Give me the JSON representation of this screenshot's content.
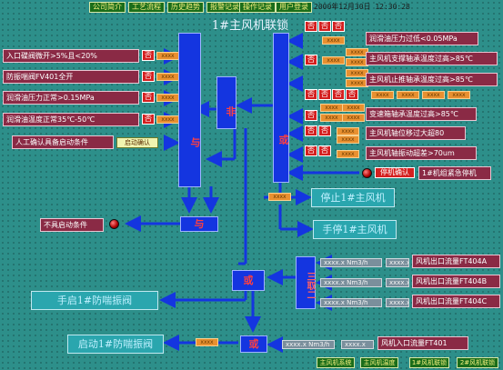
{
  "menu": [
    "公司简介",
    "工艺流程",
    "历史趋势",
    "报警记录",
    "操作记录",
    "用户登录"
  ],
  "datetime": "2000年12月30日  12:30:28",
  "title": "1#主风机联锁",
  "left_conditions": [
    {
      "label": "入口碟阀微开>5%且<20%",
      "state": "否",
      "value": "xxxx"
    },
    {
      "label": "防振喘阀FV401全开",
      "state": "否",
      "value": "xxxx"
    },
    {
      "label": "润滑油压力正常>0.15MPa",
      "state": "否",
      "value": "xxxx"
    },
    {
      "label": "润滑油温度正常35℃-50℃",
      "state": "否",
      "value": "xxxx"
    },
    {
      "label": "人工确认具备启动条件",
      "confirm": "启动确认"
    }
  ],
  "right_conditions": [
    {
      "label": "润滑油压力过低<0.05MPa",
      "states": [
        "否",
        "否",
        "否"
      ]
    },
    {
      "label": "主风机支撑轴承温度过高>85℃",
      "states": [
        "否",
        "否",
        "否",
        "否"
      ]
    },
    {
      "label": "主风机止推轴承温度过高>85℃",
      "states": [
        "否",
        "否",
        "否",
        "否"
      ]
    },
    {
      "label": "变速箱轴承温度过高>85℃",
      "states": [
        "否",
        "否",
        "否",
        "否"
      ]
    },
    {
      "label": "主风机轴位移过大超80",
      "states": [
        "否",
        "否"
      ]
    },
    {
      "label": "主风机轴振动超差>70um",
      "states": [
        "否",
        "否"
      ]
    },
    {
      "label": "1#机组紧急停机",
      "confirm": "停机确认"
    }
  ],
  "blocks": {
    "and1": "与",
    "or1": "或",
    "not1": "非",
    "and2": "与",
    "or2": "或",
    "or3": "或",
    "triple": "三取二"
  },
  "actions": {
    "stop": "停止1#主风机",
    "manual_stop": "手停1#主风机",
    "manual_valve": "手启1#防喘振阀",
    "start_valve": "启动1#防喘振阀"
  },
  "not_ready": "不具启动条件",
  "xx_small": "xxxx",
  "outlet_flows": [
    {
      "label": "风机出口流量FT404A",
      "value": "xxxx.x Nm3/h"
    },
    {
      "label": "风机出口流量FT404B",
      "value": "xxxx.x Nm3/h"
    },
    {
      "label": "风机出口流量FT404C",
      "value": "xxxx.x Nm3/h"
    }
  ],
  "inlet_flow": {
    "label": "风机入口流量FT401",
    "value": "xxxx.x Nm3/h",
    "value2": "xxxx.x"
  },
  "mid_values": [
    "xxxx.x Nm3/h",
    "xxxx.x Nm3/h",
    "xxxx.x Nm3/h"
  ],
  "bottom_nav": [
    "主风机系统",
    "主风机温度",
    "1#风机联锁",
    "2#风机联锁"
  ],
  "colors": {
    "background": "#2d8f8a",
    "block": "#1435e0",
    "condition": "#8a2a45",
    "alarm": "#d42020"
  }
}
